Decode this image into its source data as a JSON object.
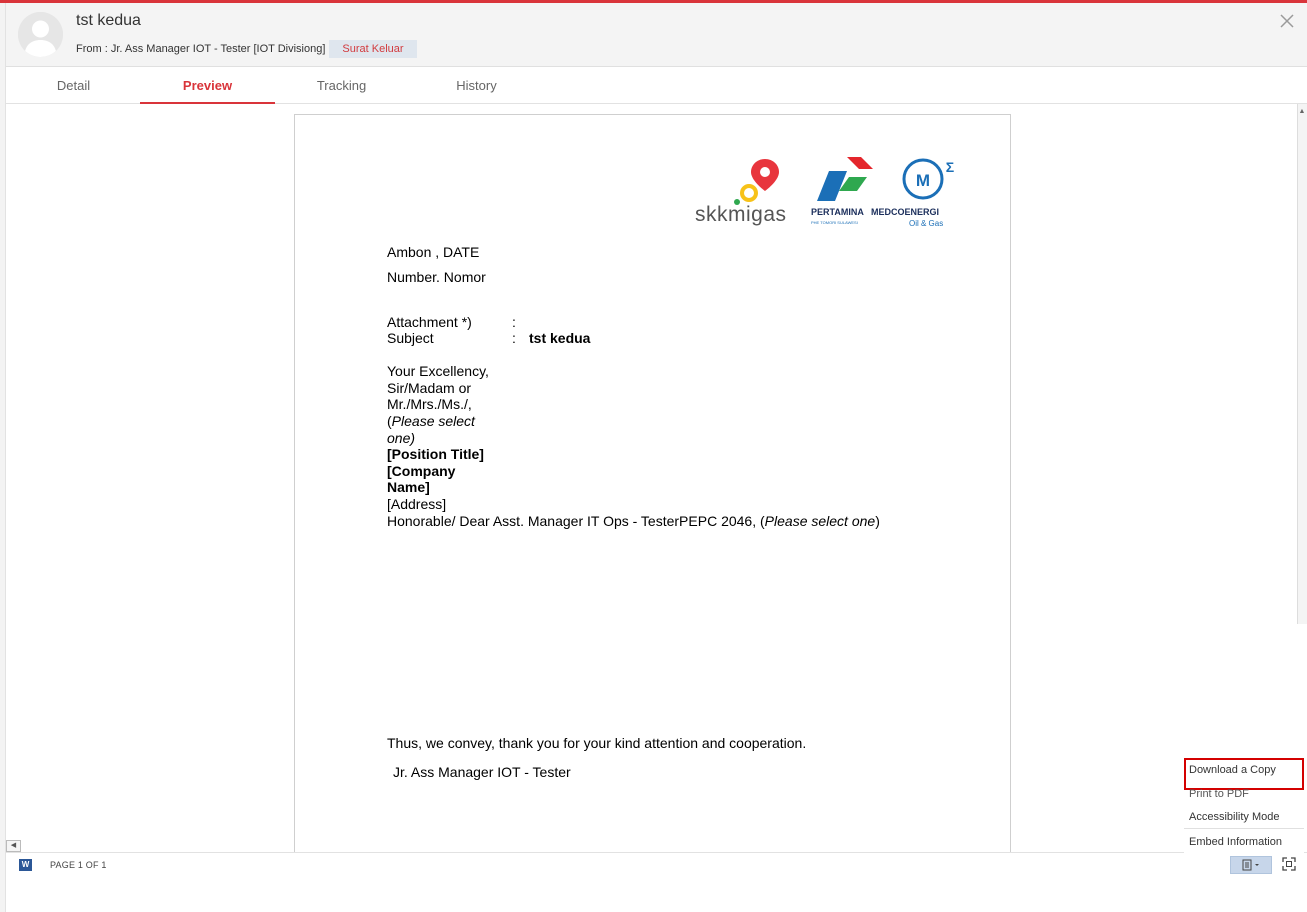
{
  "header": {
    "title": "tst kedua",
    "from_text": "From : Jr. Ass Manager IOT - Tester [IOT Divisiong]",
    "badge_label": "Surat Keluar"
  },
  "tabs": [
    "Detail",
    "Preview",
    "Tracking",
    "History"
  ],
  "active_tab": "Preview",
  "document": {
    "logos": {
      "skk": "skkmigas",
      "pertamina": "PERTAMINA",
      "pertamina_sub": "PHE TOMORI SULAWESI",
      "medco": "MEDCOENERGI",
      "medco_sub": "Oil & Gas"
    },
    "place_date": "Ambon , DATE",
    "number": "Number. Nomor",
    "attachment_label": "Attachment *)",
    "attachment_sep": ":",
    "subject_label": "Subject",
    "subject_sep": ":",
    "subject_value": "tst kedua",
    "addr_line1": "Your Excellency,",
    "addr_line2": "Sir/Madam or",
    "addr_line3": "Mr./Mrs./Ms./,",
    "addr_line4a": "(",
    "addr_line4b": "Please select",
    "addr_line5": "one)",
    "addr_line6": "[Position Title]",
    "addr_line7": "[Company",
    "addr_line8": "Name]",
    "addr_line9": "[Address]",
    "greeting_a": "Honorable/  Dear Asst. Manager IT Ops - TesterPEPC 2046, (",
    "greeting_b": "Please select one",
    "greeting_c": ")",
    "closing": "Thus, we convey, thank you for your kind attention and cooperation.",
    "signature": "Jr. Ass Manager IOT - Tester"
  },
  "status": {
    "word_icon": "W",
    "page_count": "PAGE 1 OF 1"
  },
  "menu": {
    "items": [
      "Download a Copy",
      "Print to PDF",
      "Accessibility Mode",
      "Embed Information"
    ]
  },
  "colors": {
    "accent": "#d9343a",
    "badge_bg": "#dfe6ee",
    "pertamina_red": "#e4262c",
    "pertamina_blue": "#1b6fb7",
    "pertamina_green": "#2fa84f",
    "skk_red": "#e8353d",
    "skk_yellow": "#f7c219"
  }
}
